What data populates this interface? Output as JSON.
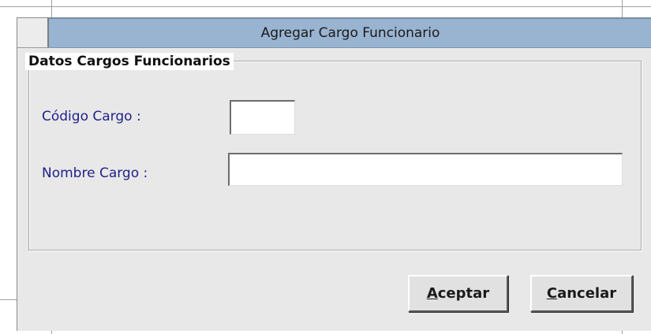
{
  "dialog": {
    "title": "Agregar Cargo Funcionario"
  },
  "group": {
    "legend": "Datos Cargos Funcionarios"
  },
  "fields": {
    "codigo_label": "Código Cargo :",
    "codigo_value": "",
    "nombre_label": "Nombre Cargo :",
    "nombre_value": ""
  },
  "buttons": {
    "accept_mnemonic": "A",
    "accept_rest": "ceptar",
    "cancel_mnemonic": "C",
    "cancel_rest": "ancelar"
  },
  "colors": {
    "titlebar": "#99b4d1",
    "dialog_bg": "#e8e8e8",
    "label_text": "#1f1f8a"
  }
}
